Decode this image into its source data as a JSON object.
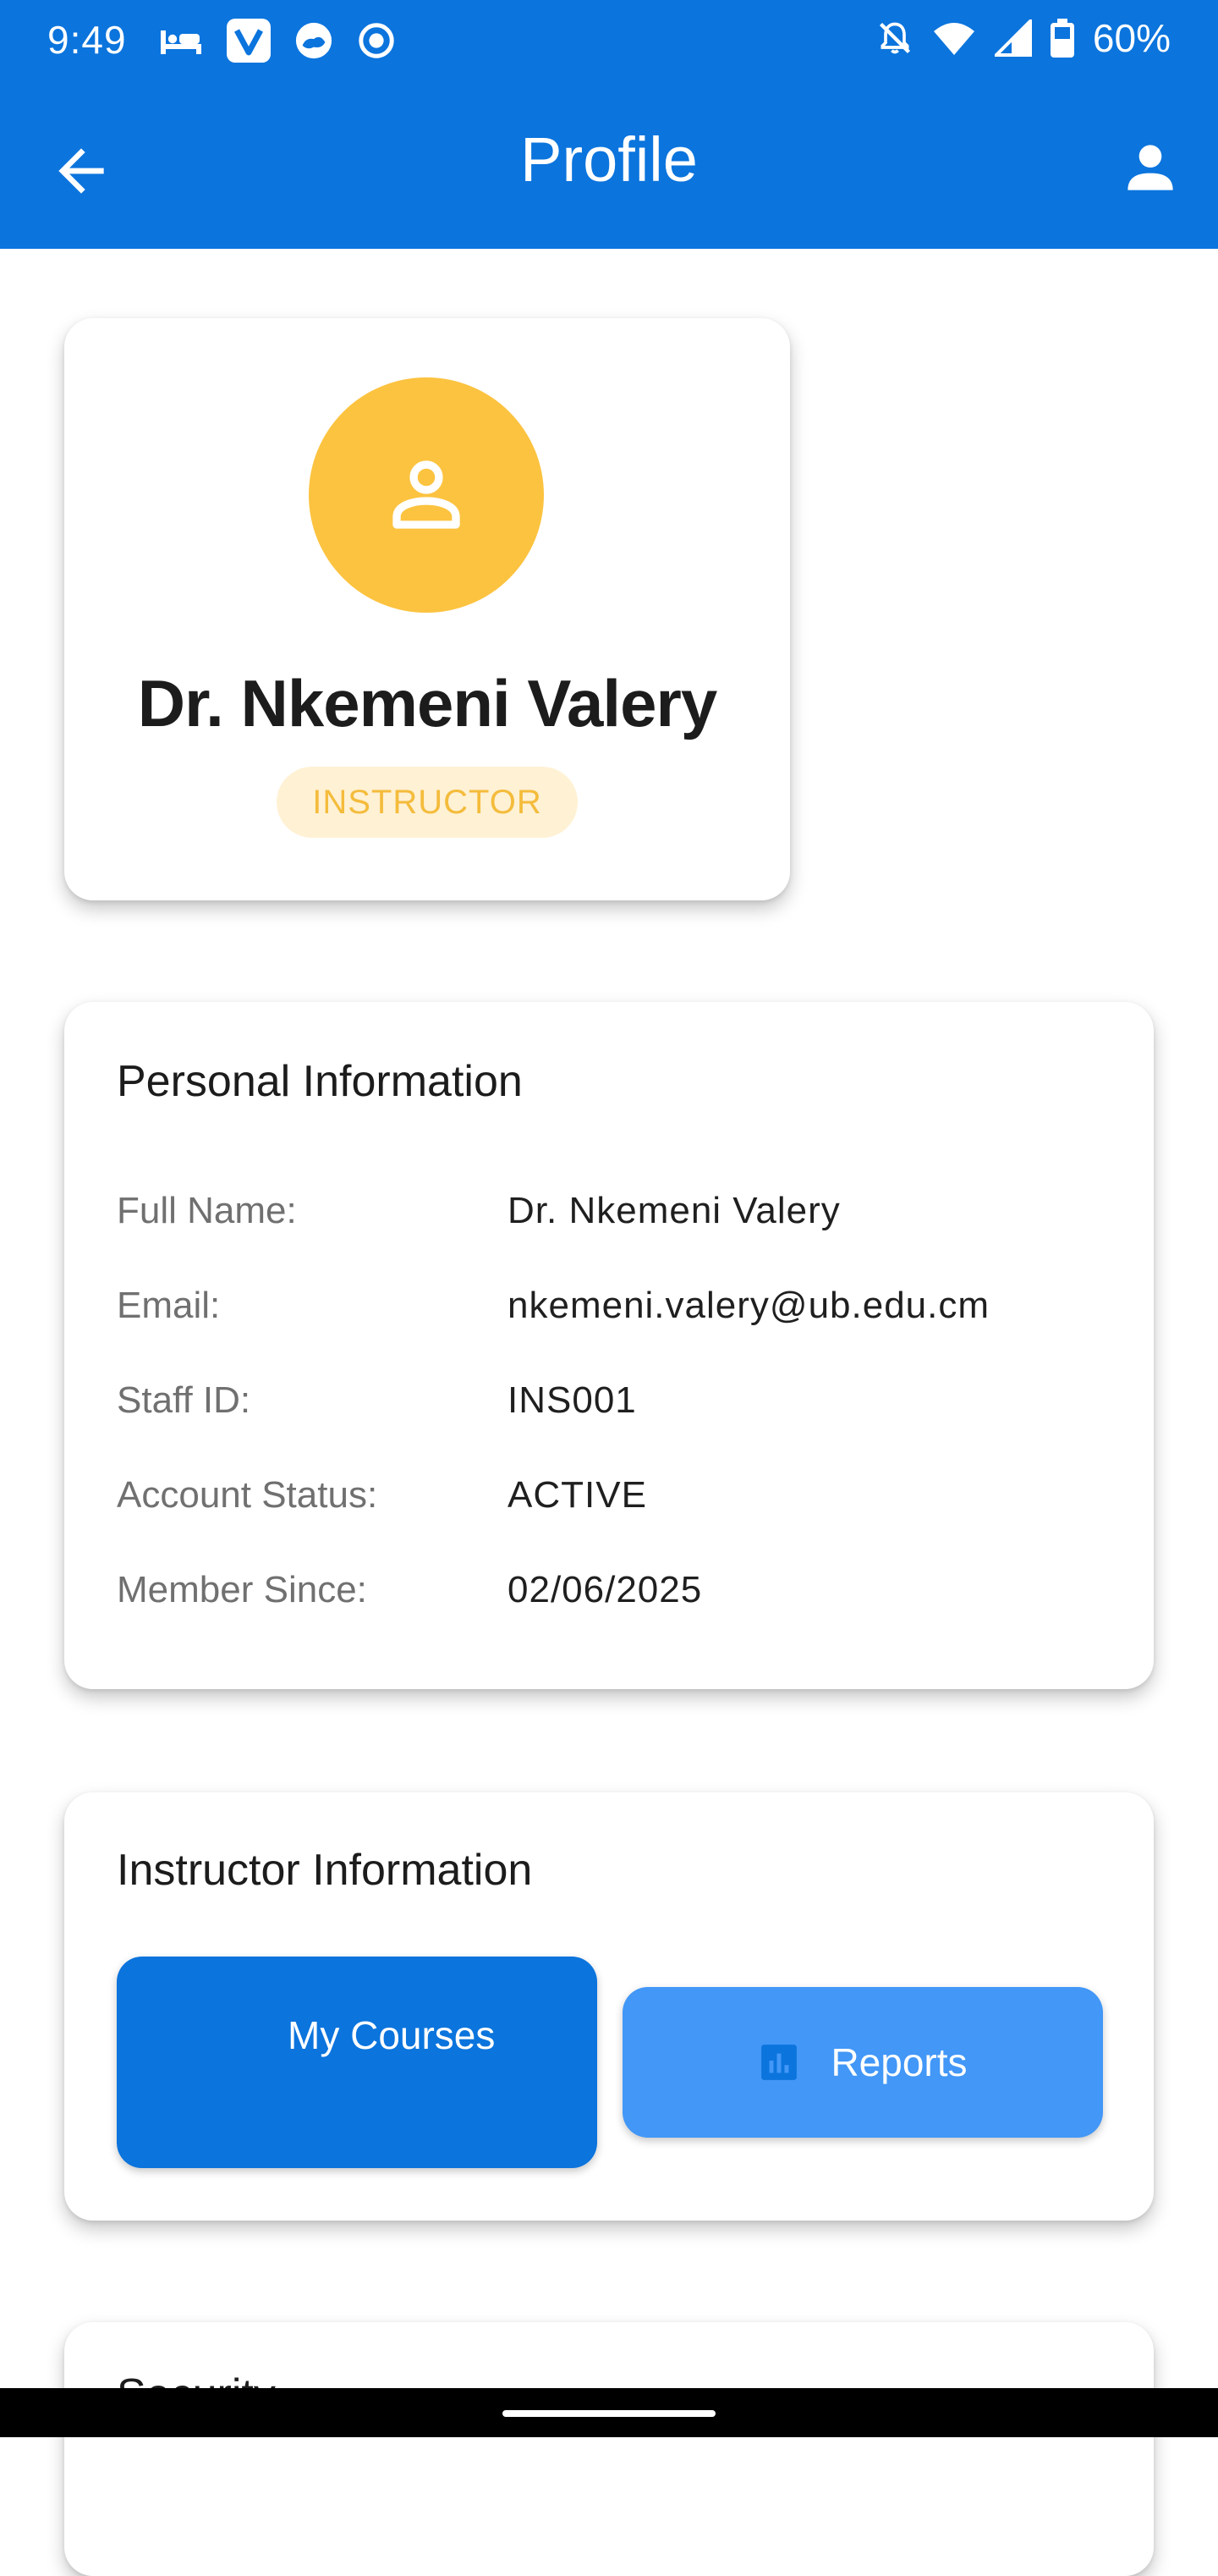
{
  "status_bar": {
    "time": "9:49",
    "battery": "60%",
    "icons": [
      "hotel-icon",
      "v-app-icon",
      "cloud-app-icon",
      "record-icon",
      "bell-off-icon",
      "wifi-icon",
      "signal-icon",
      "battery-icon"
    ]
  },
  "app_bar": {
    "title": "Profile",
    "back_icon": "arrow-back-icon",
    "account_icon": "person-icon",
    "color": "#0b74dd"
  },
  "profile": {
    "name": "Dr. Nkemeni Valery",
    "role": "INSTRUCTOR",
    "avatar_icon": "person-outline-icon",
    "avatar_color": "#fcc340"
  },
  "personal_info": {
    "title": "Personal Information",
    "rows": [
      {
        "label": "Full Name:",
        "value": "Dr. Nkemeni Valery"
      },
      {
        "label": "Email:",
        "value": "nkemeni.valery@ub.edu.cm"
      },
      {
        "label": "Staff ID:",
        "value": "INS001"
      },
      {
        "label": "Account Status:",
        "value": "ACTIVE"
      },
      {
        "label": "Member Since:",
        "value": "02/06/2025"
      }
    ]
  },
  "instructor_info": {
    "title": "Instructor Information",
    "courses_button": "My Courses",
    "reports_button": "Reports",
    "reports_icon": "bar-chart-icon",
    "primary_color": "#0b74dd",
    "secondary_color": "#4297f7"
  },
  "security": {
    "title": "Security"
  }
}
